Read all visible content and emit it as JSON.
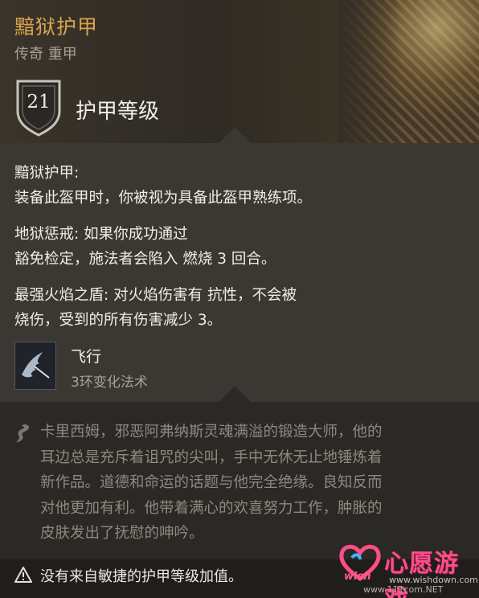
{
  "item": {
    "name": "黯狱护甲",
    "type": "传奇 重甲",
    "armor_class_value": "21",
    "armor_class_label": "护甲等级"
  },
  "effects": [
    {
      "lines": [
        "黯狱护甲:",
        "装备此盔甲时，你被视为具备此盔甲熟练项。"
      ]
    },
    {
      "lines": [
        "地狱惩戒: 如果你成功通过",
        "豁免检定，施法者会陷入 燃烧 3 回合。"
      ]
    },
    {
      "lines": [
        "最强火焰之盾: 对火焰伤害有 抗性，不会被",
        "烧伤，受到的所有伤害减少 3。"
      ]
    }
  ],
  "spell": {
    "name": "飞行",
    "subtitle": "3环变化法术",
    "icon": "flying-wing-icon"
  },
  "lore": {
    "icon": "quill-icon",
    "lines": [
      "卡里西姆，邪恶阿弗纳斯灵魂满溢的锻造大师，他的",
      "耳边总是充斥着诅咒的尖叫，手中无休无止地锤炼着",
      "新作品。道德和命运的话题与他完全绝缘。良知反而",
      "对他更加有利。他带着满心的欢喜努力工作，肿胀的",
      "皮肤发出了抚慰的呻吟。"
    ]
  },
  "footer": {
    "icon": "warning-icon",
    "text": "没有来自敏捷的护甲等级加值。"
  },
  "watermark": {
    "brand": "心愿游戏",
    "wish": "wish",
    "url": "www.wishdown.com",
    "url2": "www.111com.NET"
  },
  "colors": {
    "item_name": "#d9a54f",
    "secondary_text": "#a8a095",
    "lore_text": "#8e887e",
    "watermark": "#ff4d8a"
  }
}
